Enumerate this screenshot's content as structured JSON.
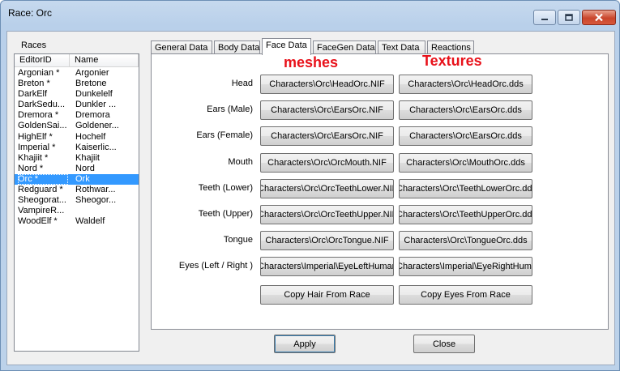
{
  "window": {
    "title": "Race: Orc",
    "controls": {
      "minimize": "minimize-icon",
      "maximize": "maximize-icon",
      "close": "close-icon"
    }
  },
  "races": {
    "label": "Races",
    "columns": [
      "EditorID",
      "Name"
    ],
    "rows": [
      {
        "id": "Argonian *",
        "name": "Argonier"
      },
      {
        "id": "Breton *",
        "name": "Bretone"
      },
      {
        "id": "DarkElf",
        "name": "Dunkelelf"
      },
      {
        "id": "DarkSedu...",
        "name": "Dunkler ..."
      },
      {
        "id": "Dremora *",
        "name": "Dremora"
      },
      {
        "id": "GoldenSai...",
        "name": "Goldener..."
      },
      {
        "id": "HighElf *",
        "name": "Hochelf"
      },
      {
        "id": "Imperial *",
        "name": "Kaiserlic..."
      },
      {
        "id": "Khajiit *",
        "name": "Khajiit"
      },
      {
        "id": "Nord *",
        "name": "Nord"
      },
      {
        "id": "Orc *",
        "name": "Ork"
      },
      {
        "id": "Redguard *",
        "name": "Rothwar..."
      },
      {
        "id": "Sheogorat...",
        "name": "Sheogor..."
      },
      {
        "id": "VampireR...",
        "name": ""
      },
      {
        "id": "WoodElf *",
        "name": "Waldelf"
      }
    ],
    "selected_index": 10
  },
  "tabs": [
    "General Data",
    "Body Data",
    "Face Data",
    "FaceGen Data",
    "Text Data",
    "Reactions"
  ],
  "active_tab": "Face Data",
  "annotations": {
    "meshes": "meshes",
    "textures": "Textures"
  },
  "face_rows": [
    {
      "label": "Head",
      "mesh": "Characters\\Orc\\HeadOrc.NIF",
      "texture": "Characters\\Orc\\HeadOrc.dds"
    },
    {
      "label": "Ears (Male)",
      "mesh": "Characters\\Orc\\EarsOrc.NIF",
      "texture": "Characters\\Orc\\EarsOrc.dds"
    },
    {
      "label": "Ears (Female)",
      "mesh": "Characters\\Orc\\EarsOrc.NIF",
      "texture": "Characters\\Orc\\EarsOrc.dds"
    },
    {
      "label": "Mouth",
      "mesh": "Characters\\Orc\\OrcMouth.NIF",
      "texture": "Characters\\Orc\\MouthOrc.dds"
    },
    {
      "label": "Teeth (Lower)",
      "mesh": "Characters\\Orc\\OrcTeethLower.NIF",
      "texture": "Characters\\Orc\\TeethLowerOrc.dds"
    },
    {
      "label": "Teeth (Upper)",
      "mesh": "Characters\\Orc\\OrcTeethUpper.NIF",
      "texture": "Characters\\Orc\\TeethUpperOrc.dds"
    },
    {
      "label": "Tongue",
      "mesh": "Characters\\Orc\\OrcTongue.NIF",
      "texture": "Characters\\Orc\\TongueOrc.dds"
    },
    {
      "label": "Eyes (Left / Right )",
      "mesh": "Characters\\Imperial\\EyeLeftHuman.NIF",
      "texture": "Characters\\Imperial\\EyeRightHuman.dds"
    }
  ],
  "copy_buttons": {
    "hair": "Copy Hair From Race",
    "eyes": "Copy Eyes From Race"
  },
  "footer": {
    "apply": "Apply",
    "close": "Close"
  },
  "colors": {
    "annotation": "#e8111a",
    "selection": "#3399ff"
  }
}
